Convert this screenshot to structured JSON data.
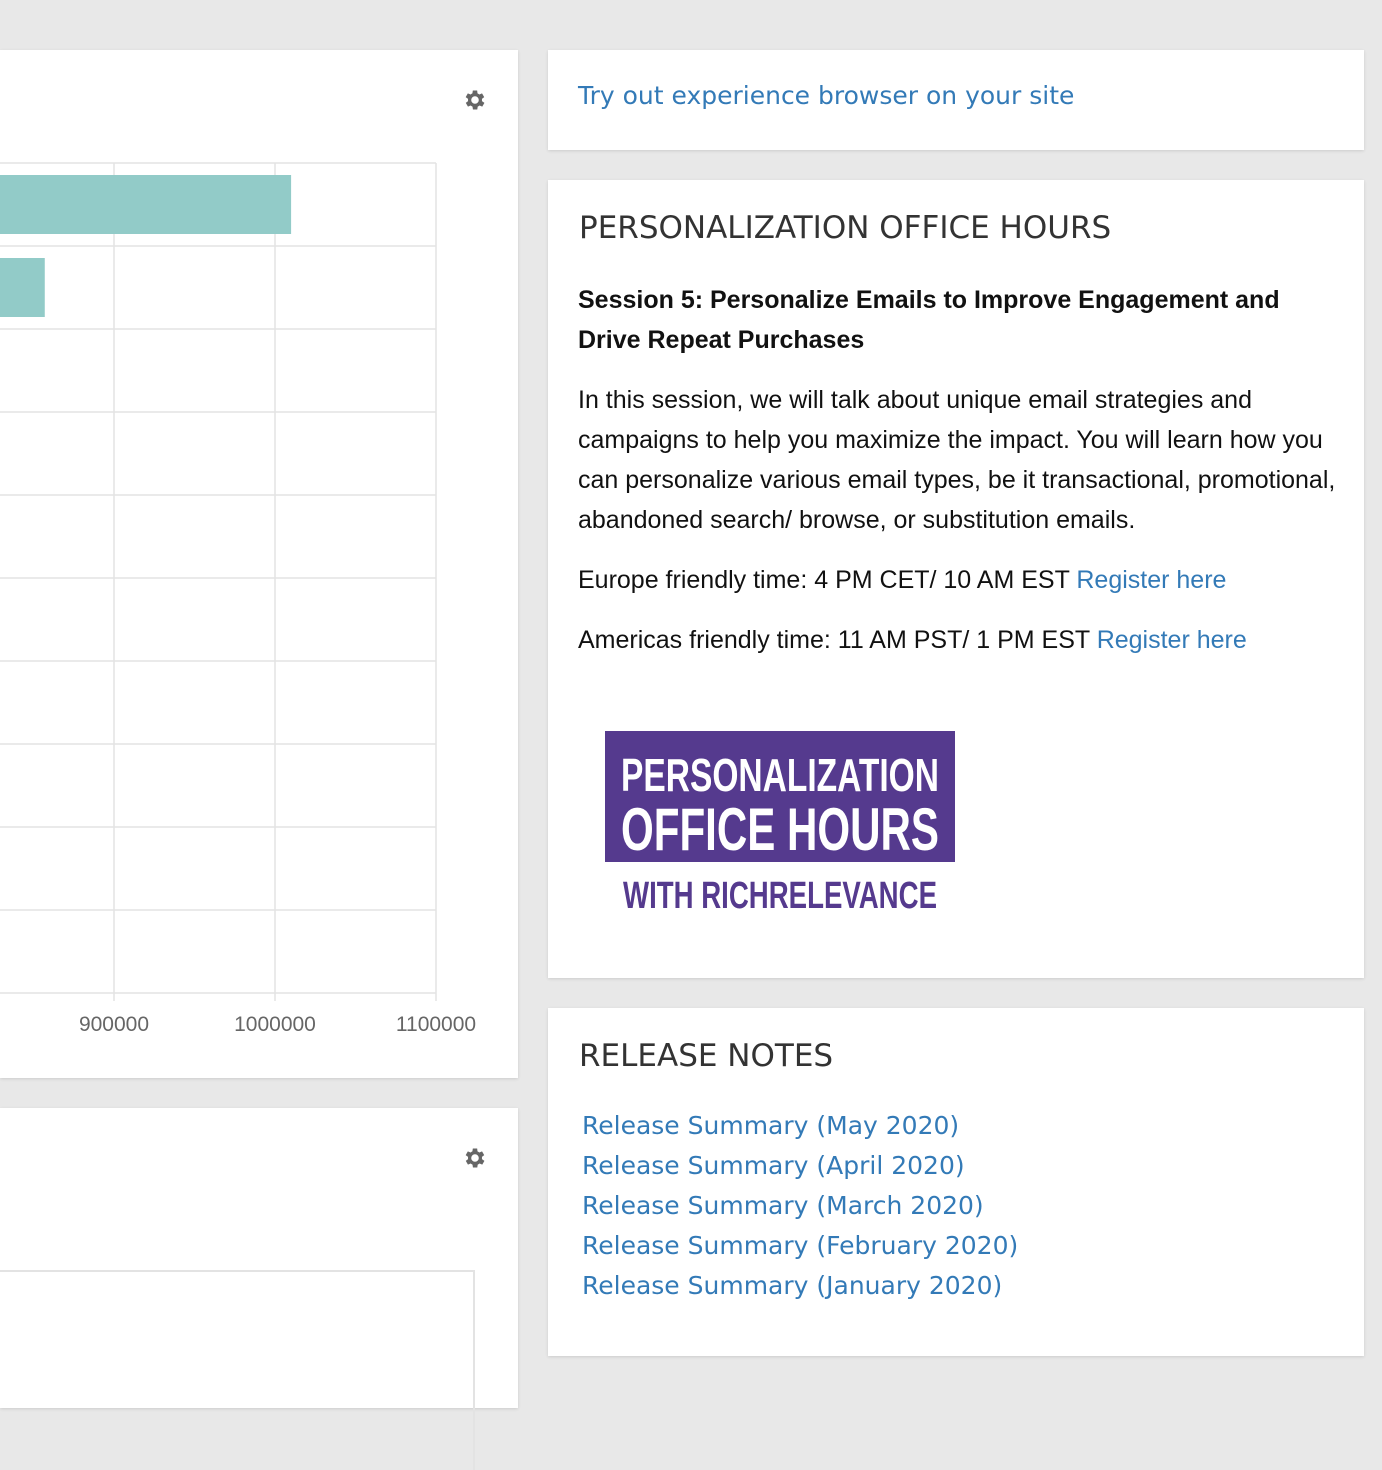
{
  "chart": {
    "chart_data": {
      "type": "bar",
      "orientation": "horizontal",
      "x_ticks": [
        900000,
        1000000,
        1100000
      ],
      "visible_bars": [
        {
          "value": 1010000
        },
        {
          "value": 857000
        }
      ],
      "grid": true,
      "colors": {
        "bar": "#92cbc8",
        "grid": "#e3e3e3"
      }
    },
    "settings_icon": "gear-icon"
  },
  "table_panel": {
    "settings_icon": "gear-icon"
  },
  "try_panel": {
    "link_text": "Try out experience browser on your site"
  },
  "office_hours": {
    "title": "PERSONALIZATION OFFICE HOURS",
    "session_title": "Session 5: Personalize Emails to Improve Engagement and Drive Repeat Purchases",
    "description": "In this session, we will talk about unique email strategies and campaigns to help you maximize the impact. You will learn how you can personalize various email types, be it transactional, promotional, abandoned search/ browse, or substitution emails.",
    "europe_time": "Europe friendly time: 4 PM CET/ 10 AM EST",
    "americas_time": "Americas friendly time: 11 AM PST/ 1 PM EST",
    "register_label": "Register here",
    "logo": {
      "line1": "PERSONALIZATION",
      "line2": "OFFICE HOURS",
      "line3": "WITH RICHRELEVANCE",
      "bg_color": "#553a8e",
      "text_color": "#ffffff",
      "subtitle_color": "#553a8e"
    }
  },
  "release_notes": {
    "title": "RELEASE NOTES",
    "items": [
      "Release Summary (May 2020)",
      "Release Summary (April 2020)",
      "Release Summary (March 2020)",
      "Release Summary (February 2020)",
      "Release Summary (January 2020)"
    ]
  },
  "colors": {
    "link": "#337ab7",
    "background": "#e8e8e8",
    "panel": "#ffffff",
    "icon": "#666666"
  }
}
